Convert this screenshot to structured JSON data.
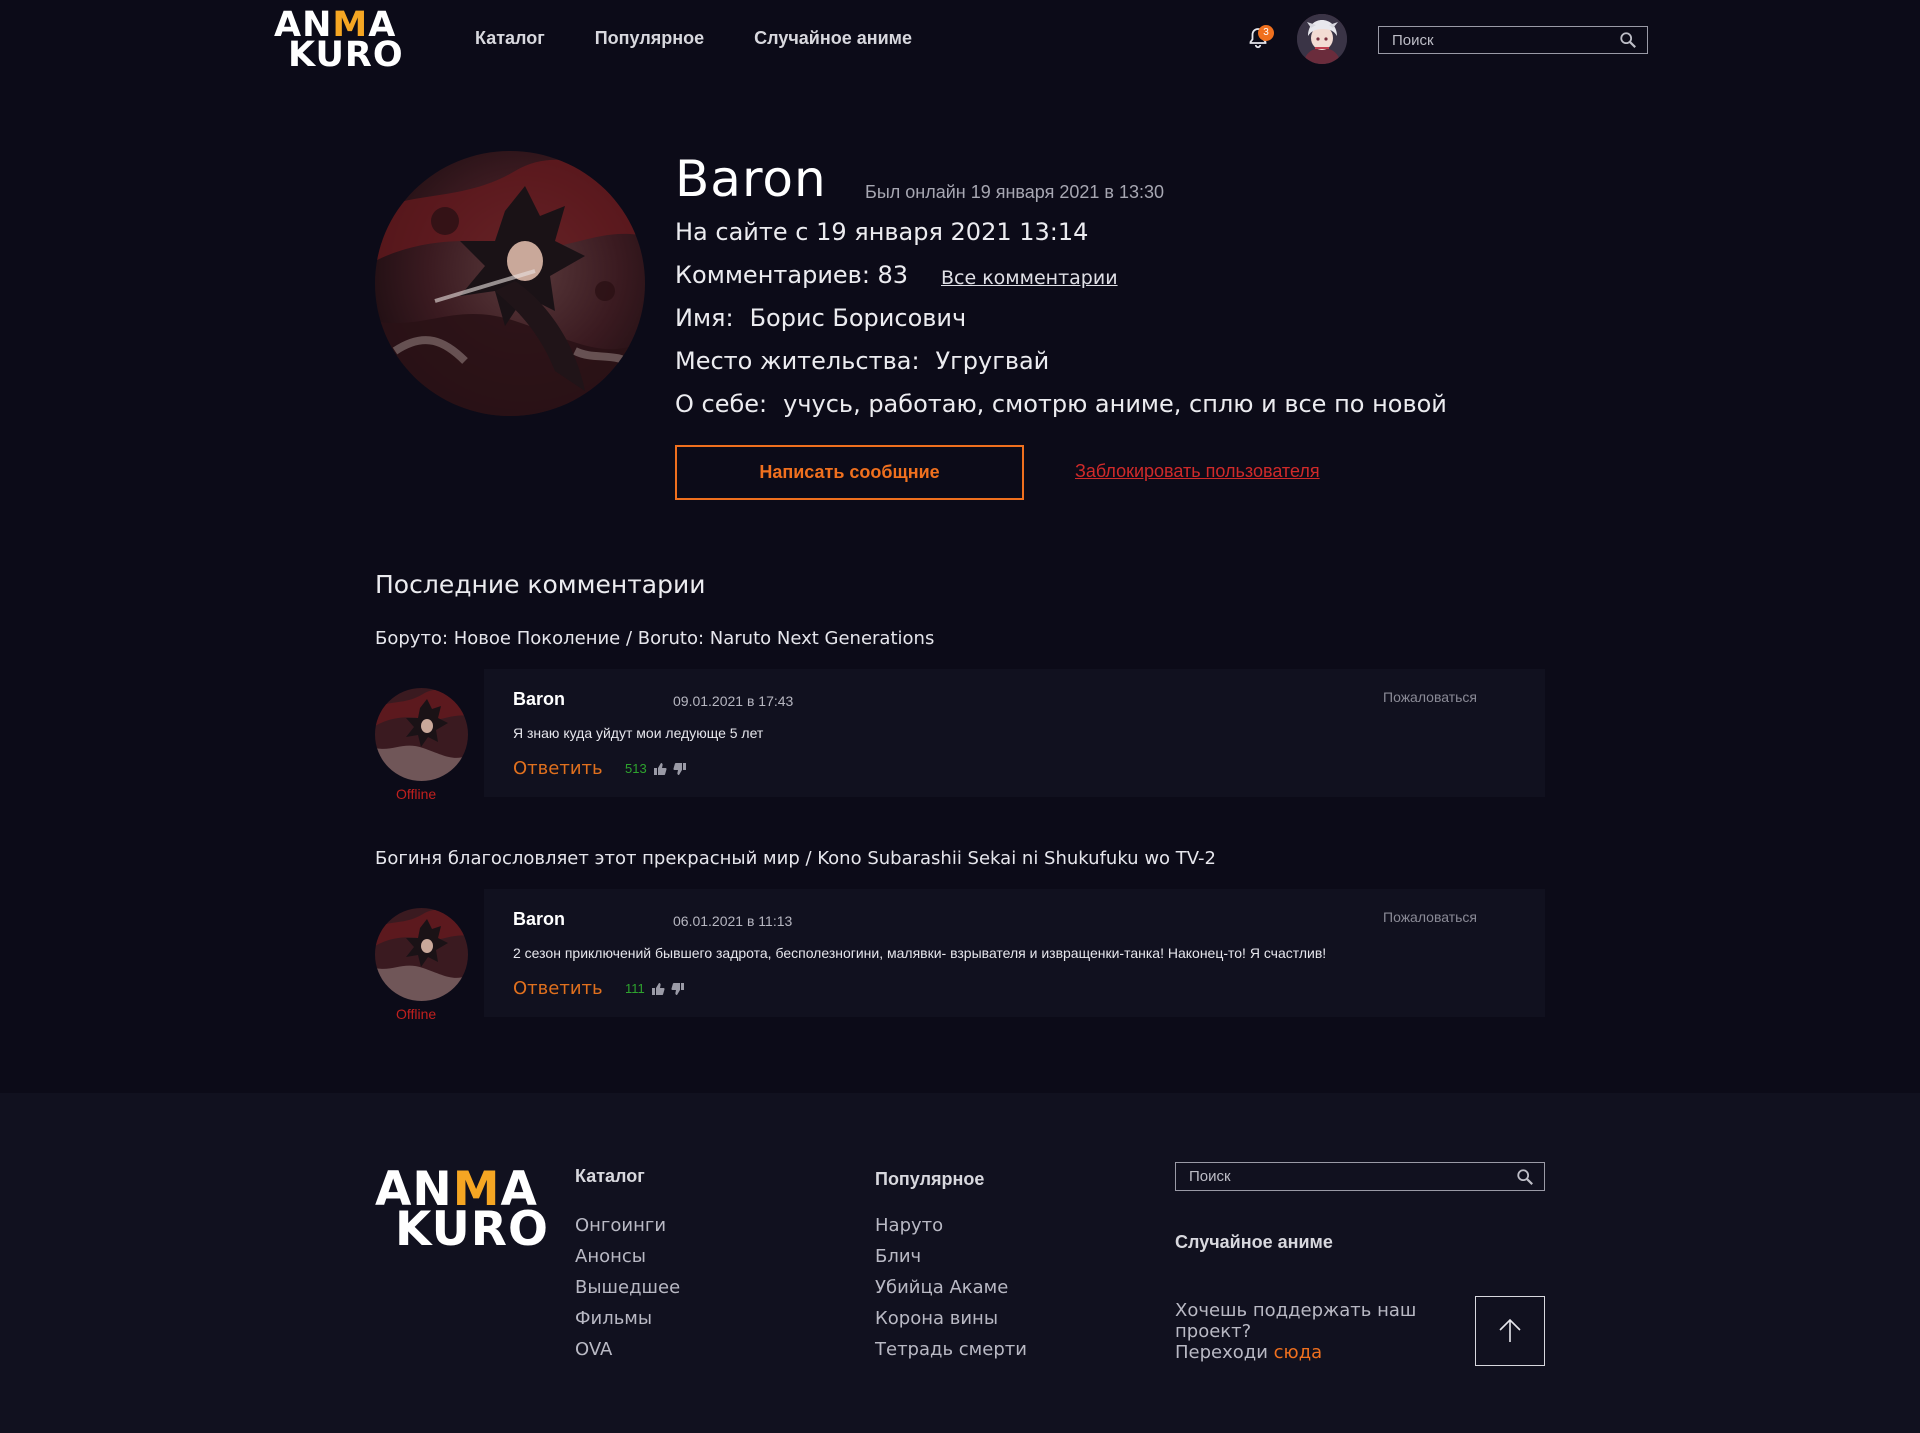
{
  "header": {
    "logo_line1": [
      "AN",
      "M",
      "A"
    ],
    "logo_line2": "KURO",
    "nav": [
      {
        "label": "Каталог"
      },
      {
        "label": "Популярное"
      },
      {
        "label": "Случайное аниме"
      }
    ],
    "notifications_count": "3",
    "search_placeholder": "Поиск"
  },
  "profile": {
    "name": "Baron",
    "last_online": "Был онлайн 19 января 2021 в 13:30",
    "since_label": "На сайте с 19 января 2021  13:14",
    "comments_label": "Комментариев: 83",
    "all_comments_link": "Все комментарии",
    "name_label": "Имя:",
    "name_value": "Борис Борисович",
    "location_label": "Место жительства:",
    "location_value": "Угругвай",
    "about_label": "О себе:",
    "about_value": "учусь, работаю, смотрю аниме, сплю и все по новой",
    "message_button": "Написать сообщние",
    "block_link": "Заблокировать пользователя"
  },
  "comments_section": {
    "title": "Последние комментарии",
    "items": [
      {
        "anime": "Боруто: Новое Поколение / Boruto: Naruto Next Generations",
        "author": "Baron",
        "date": "09.01.2021 в 17:43",
        "report": "Пожаловаться",
        "text": "Я знаю куда уйдут мои ледующе 5 лет",
        "reply": "Ответить",
        "score": "513",
        "status": "Offline"
      },
      {
        "anime": "Богиня благословляет этот прекрасный мир / Kono Subarashii Sekai ni Shukufuku wo TV-2",
        "author": "Baron",
        "date": "06.01.2021 в 11:13",
        "report": "Пожаловаться",
        "text": "2 сезон приключений бывшего задрота, бесполезногини, малявки- взрывателя и извращенки-танка! Наконец-то! Я счастлив!",
        "reply": "Ответить",
        "score": "111",
        "status": "Offline"
      }
    ]
  },
  "footer": {
    "catalog": {
      "title": "Каталог",
      "items": [
        "Онгоинги",
        "Анонсы",
        "Вышедшее",
        "Фильмы",
        "OVA"
      ]
    },
    "popular": {
      "title": "Популярное",
      "items": [
        "Наруто",
        "Блич",
        "Убийца Акаме",
        "Корона вины",
        "Тетрадь смерти"
      ]
    },
    "search_placeholder": "Поиск",
    "random": "Случайное аниме",
    "support_text": "Хочешь поддержать наш проект?",
    "support_go": "Переходи ",
    "support_link": "сюда"
  },
  "colors": {
    "background": "#0c0b18",
    "accent": "#f0701e",
    "logo_accent": "#f5a623",
    "danger": "#d02a2a",
    "positive": "#2ea32e"
  }
}
